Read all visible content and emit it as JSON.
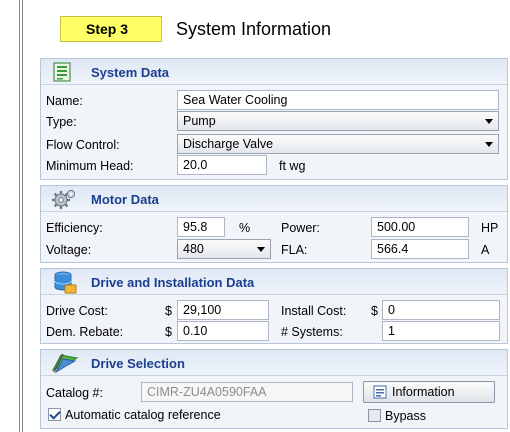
{
  "step": {
    "badge": "Step 3",
    "title": "System Information"
  },
  "system_data": {
    "title": "System Data",
    "name_label": "Name:",
    "name_value": "Sea Water Cooling",
    "type_label": "Type:",
    "type_value": "Pump",
    "flow_label": "Flow Control:",
    "flow_value": "Discharge Valve",
    "head_label": "Minimum Head:",
    "head_value": "20.0",
    "head_unit": "ft wg"
  },
  "motor_data": {
    "title": "Motor Data",
    "efficiency_label": "Efficiency:",
    "efficiency_value": "95.8",
    "efficiency_unit": "%",
    "power_label": "Power:",
    "power_value": "500.00",
    "power_unit": "HP",
    "voltage_label": "Voltage:",
    "voltage_value": "480",
    "fla_label": "FLA:",
    "fla_value": "566.4",
    "fla_unit": "A"
  },
  "drive_install": {
    "title": "Drive and Installation Data",
    "drive_cost_label": "Drive Cost:",
    "drive_cost_currency": "$",
    "drive_cost_value": "29,100",
    "install_cost_label": "Install Cost:",
    "install_cost_currency": "$",
    "install_cost_value": "0",
    "rebate_label": "Dem. Rebate:",
    "rebate_currency": "$",
    "rebate_value": "0.10",
    "systems_label": "# Systems:",
    "systems_value": "1"
  },
  "drive_selection": {
    "title": "Drive Selection",
    "catalog_label": "Catalog #:",
    "catalog_value": "CIMR-ZU4A0590FAA",
    "info_button": "Information",
    "auto_label": "Automatic catalog reference",
    "auto_checked": true,
    "bypass_label": "Bypass",
    "bypass_checked": false
  },
  "colors": {
    "badge_bg": "#ffff66",
    "section_title": "#1b3f8f",
    "panel_bg": "#f1f4f9"
  }
}
